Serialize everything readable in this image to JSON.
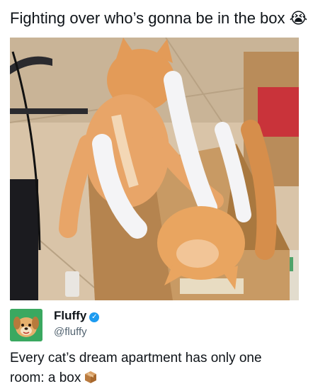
{
  "post": {
    "headline": "Fighting over who’s gonna be in the box",
    "headline_emoji": "😭",
    "author_name": "Fluffy",
    "author_handle": "@fluffy",
    "verified_mark": "✓",
    "caption": "Every cat’s dream apartment has only one room: a box"
  },
  "icons": {
    "headline_emoji": "loudly-crying-face-icon",
    "verified": "verified-badge-icon",
    "caption_emoji": "package-box-icon",
    "avatar": "dog-avatar-icon"
  },
  "colors": {
    "avatar_bg": "#3aa860",
    "verified": "#1d9bf0",
    "handle": "#536471",
    "text": "#0f1419"
  }
}
